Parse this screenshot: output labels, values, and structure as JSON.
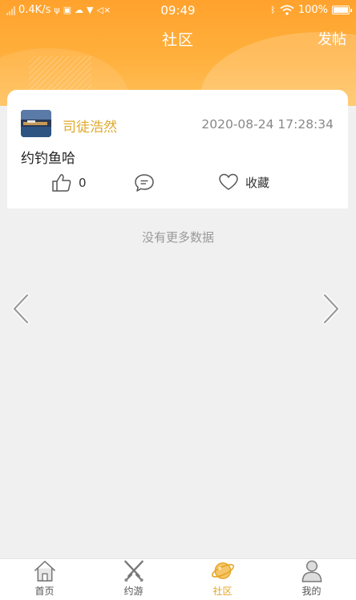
{
  "status_bar": {
    "speed": "0.4K/s",
    "time": "09:49",
    "battery": "100%"
  },
  "header": {
    "title": "社区",
    "post_label": "发帖"
  },
  "post": {
    "author": "司徒浩然",
    "timestamp": "2020-08-24 17:28:34",
    "content": "约钓鱼哈",
    "like_count": "0",
    "favorite_label": "收藏"
  },
  "feed": {
    "no_more_text": "没有更多数据"
  },
  "tabbar": {
    "tabs": [
      {
        "label": "首页",
        "icon": "home-icon"
      },
      {
        "label": "约游",
        "icon": "crossed-swords-icon"
      },
      {
        "label": "社区",
        "icon": "planet-icon",
        "active": true
      },
      {
        "label": "我的",
        "icon": "person-icon"
      }
    ]
  },
  "colors": {
    "accent": "#ffa22d",
    "author": "#e0a82a",
    "active_tab": "#e5a521"
  }
}
